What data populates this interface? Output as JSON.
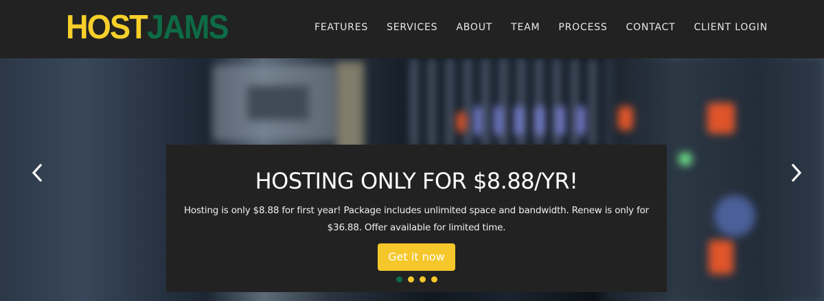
{
  "brand": {
    "part1": "HOST",
    "part2": "JAMS",
    "color1": "#f6cf2a",
    "color2": "#0d6b46"
  },
  "nav": [
    "FEATURES",
    "SERVICES",
    "ABOUT",
    "TEAM",
    "PROCESS",
    "CONTACT",
    "CLIENT LOGIN"
  ],
  "hero": {
    "prev_icon": "chevron-left-icon",
    "next_icon": "chevron-right-icon",
    "title": "HOSTING ONLY FOR $8.88/YR!",
    "text": "Hosting is only $8.88 for first year! Package includes unlimited space and bandwidth. Renew is only for $36.88. Offer available for limited time.",
    "cta": "Get it now",
    "slides": 4,
    "active_slide": 1
  },
  "colors": {
    "accent": "#f6c72b",
    "dark": "#222222",
    "green": "#0d6b46"
  }
}
